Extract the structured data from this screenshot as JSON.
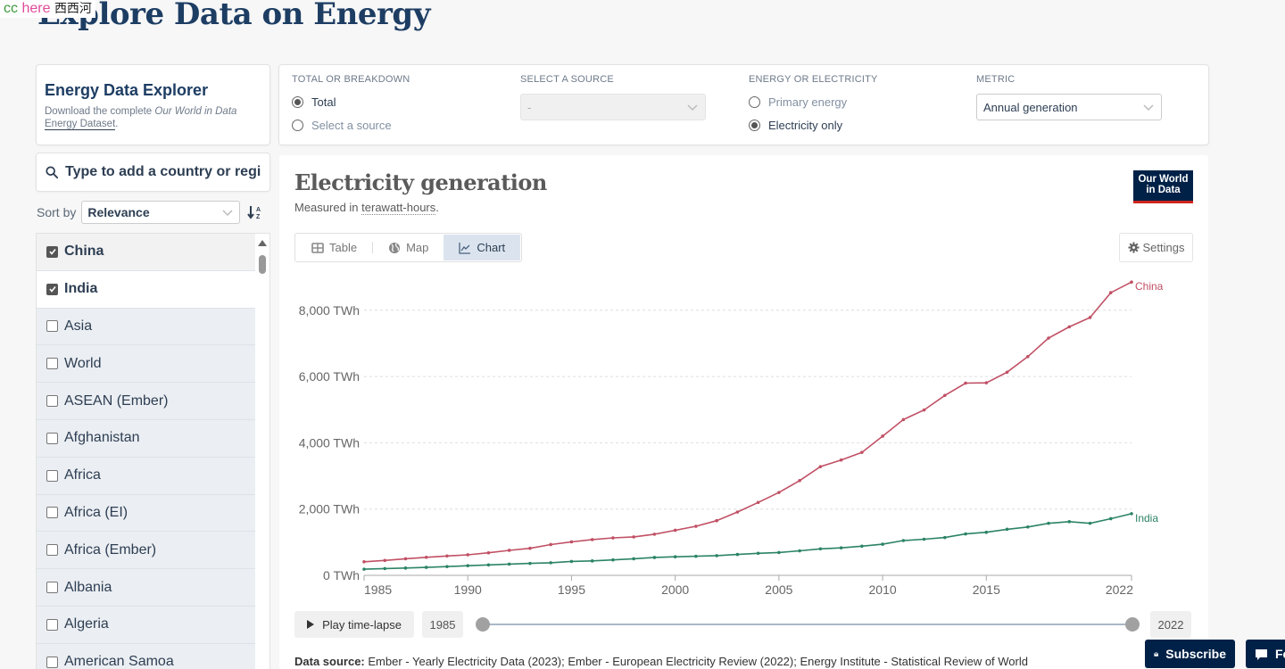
{
  "overlay_tag": {
    "part1": "cc",
    "part2": "here",
    "part3": "西西河"
  },
  "page_title": "Explore Data on Energy",
  "explorer": {
    "title": "Energy Data Explorer",
    "desc_prefix": "Download the complete ",
    "desc_em": "Our World in Data",
    "desc_link": "Energy Dataset",
    "desc_suffix": "."
  },
  "search": {
    "placeholder": "Type to add a country or region..."
  },
  "sort": {
    "label": "Sort by",
    "value": "Relevance"
  },
  "entities": [
    {
      "name": "China",
      "checked": true
    },
    {
      "name": "India",
      "checked": true
    },
    {
      "name": "Asia",
      "checked": false
    },
    {
      "name": "World",
      "checked": false
    },
    {
      "name": "ASEAN (Ember)",
      "checked": false
    },
    {
      "name": "Afghanistan",
      "checked": false
    },
    {
      "name": "Africa",
      "checked": false
    },
    {
      "name": "Africa (EI)",
      "checked": false
    },
    {
      "name": "Africa (Ember)",
      "checked": false
    },
    {
      "name": "Albania",
      "checked": false
    },
    {
      "name": "Algeria",
      "checked": false
    },
    {
      "name": "American Samoa",
      "checked": false
    }
  ],
  "controls": {
    "total_or_breakdown": {
      "label": "TOTAL OR BREAKDOWN",
      "options": [
        "Total",
        "Select a source"
      ],
      "selected": "Total"
    },
    "select_source": {
      "label": "SELECT A SOURCE",
      "value": "-"
    },
    "energy_or_electricity": {
      "label": "ENERGY OR ELECTRICITY",
      "options": [
        "Primary energy",
        "Electricity only"
      ],
      "selected": "Electricity only"
    },
    "metric": {
      "label": "METRIC",
      "value": "Annual generation"
    }
  },
  "chart_header": {
    "title": "Electricity generation",
    "subtitle_prefix": "Measured in ",
    "subtitle_unit": "terawatt-hours",
    "subtitle_suffix": ".",
    "logo_line1": "Our World",
    "logo_line2": "in Data"
  },
  "tabs": [
    {
      "label": "Table",
      "icon": "table-icon",
      "active": false
    },
    {
      "label": "Map",
      "icon": "globe-icon",
      "active": false
    },
    {
      "label": "Chart",
      "icon": "line-chart-icon",
      "active": true
    }
  ],
  "settings_label": "Settings",
  "timeline": {
    "play_label": "Play time-lapse",
    "start_year": "1985",
    "end_year": "2022",
    "start_fraction": 0,
    "end_fraction": 1
  },
  "data_source": {
    "label": "Data source:",
    "text": "Ember - Yearly Electricity Data (2023); Ember - European Electricity Review (2022); Energy Institute - Statistical Review of World"
  },
  "footer_buttons": {
    "subscribe": "Subscribe",
    "feedback": "Feedback"
  },
  "colors": {
    "china": "#c15065",
    "india": "#2c8465",
    "brand_navy": "#002147",
    "brand_red": "#ce261e"
  },
  "chart_data": {
    "type": "line",
    "title": "Electricity generation",
    "subtitle": "Measured in terawatt-hours.",
    "xlabel": "",
    "ylabel": "",
    "unit": "TWh",
    "ylim": [
      0,
      8850
    ],
    "y_ticks": [
      0,
      2000,
      4000,
      6000,
      8000
    ],
    "y_tick_labels": [
      "0 TWh",
      "2,000 TWh",
      "4,000 TWh",
      "6,000 TWh",
      "8,000 TWh"
    ],
    "x_ticks": [
      1985,
      1990,
      1995,
      2000,
      2005,
      2010,
      2015,
      2022
    ],
    "xlim": [
      1985,
      2022
    ],
    "grid": "horizontal-dashed",
    "legend": "line-end labels (right)",
    "x": [
      1985,
      1986,
      1987,
      1988,
      1989,
      1990,
      1991,
      1992,
      1993,
      1994,
      1995,
      1996,
      1997,
      1998,
      1999,
      2000,
      2001,
      2002,
      2003,
      2004,
      2005,
      2006,
      2007,
      2008,
      2009,
      2010,
      2011,
      2012,
      2013,
      2014,
      2015,
      2016,
      2017,
      2018,
      2019,
      2020,
      2021,
      2022
    ],
    "series": [
      {
        "name": "China",
        "color": "#c15065",
        "values": [
          410,
          450,
          500,
          545,
          585,
          620,
          680,
          755,
          815,
          930,
          1010,
          1080,
          1130,
          1160,
          1240,
          1360,
          1480,
          1650,
          1910,
          2200,
          2500,
          2860,
          3280,
          3480,
          3710,
          4200,
          4700,
          4990,
          5430,
          5800,
          5810,
          6130,
          6600,
          7160,
          7500,
          7780,
          8530,
          8850
        ]
      },
      {
        "name": "India",
        "color": "#2c8465",
        "values": [
          185,
          205,
          220,
          240,
          265,
          290,
          315,
          340,
          360,
          380,
          420,
          435,
          465,
          500,
          540,
          560,
          575,
          595,
          630,
          665,
          690,
          740,
          800,
          830,
          880,
          940,
          1050,
          1090,
          1140,
          1250,
          1300,
          1390,
          1460,
          1570,
          1620,
          1570,
          1710,
          1860
        ]
      }
    ]
  }
}
